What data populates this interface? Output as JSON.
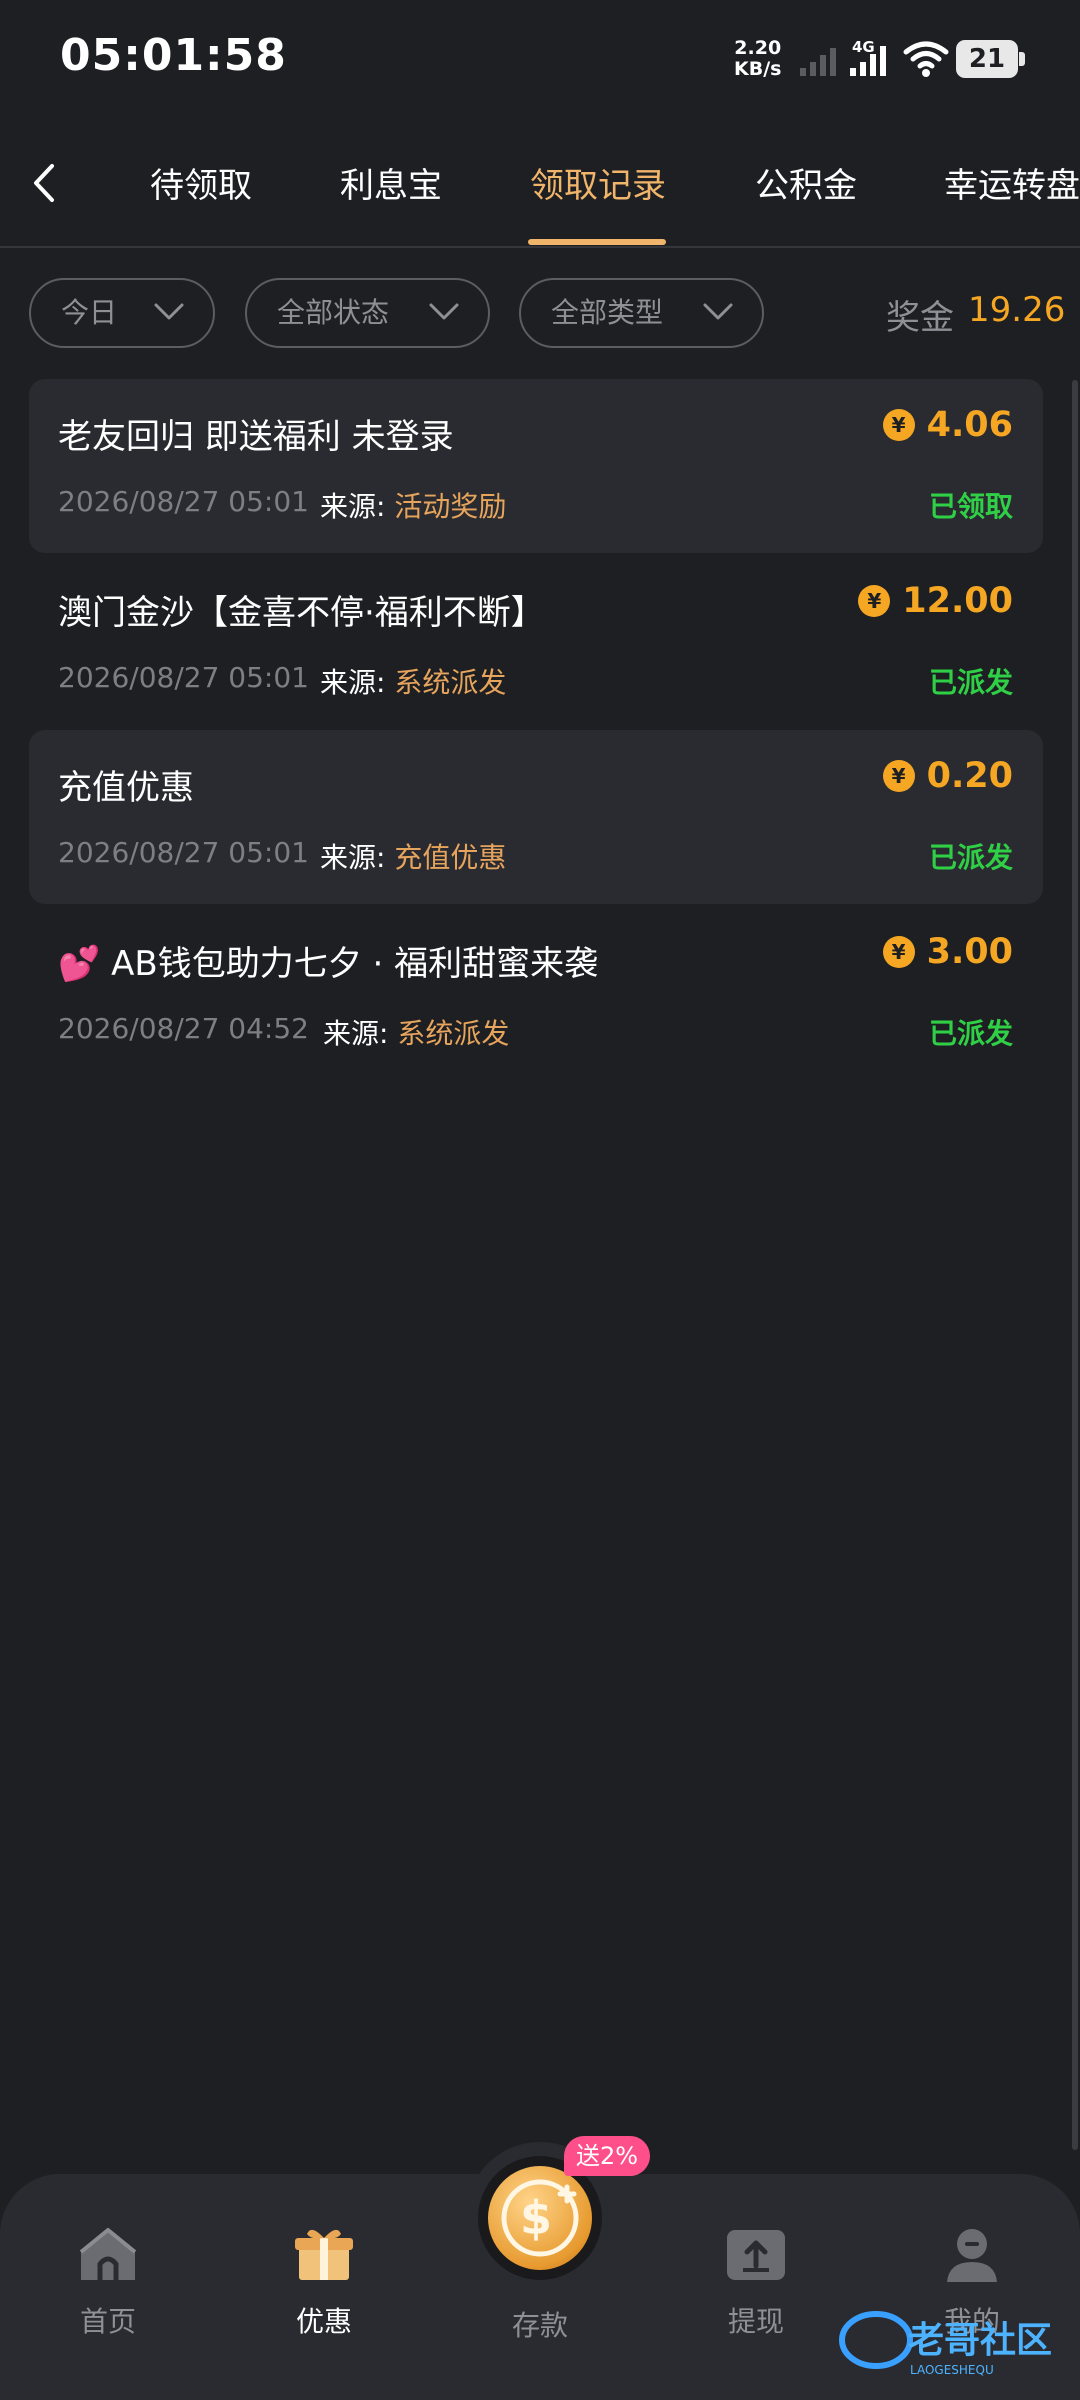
{
  "status_bar": {
    "time": "05:01:58",
    "net_speed_value": "2.20",
    "net_speed_unit": "KB/s",
    "network_type": "4G",
    "battery": "21"
  },
  "tabs": {
    "items": [
      "待领取",
      "利息宝",
      "领取记录",
      "公积金",
      "幸运转盘"
    ],
    "active": "领取记录"
  },
  "filters": {
    "date": "今日",
    "status": "全部状态",
    "type": "全部类型"
  },
  "bonus": {
    "label": "奖金",
    "value": "19.26"
  },
  "source_label": "来源:",
  "currency_symbol": "¥",
  "records": [
    {
      "title": "老友回归 即送福利 未登录",
      "date": "2026/08/27 05:01",
      "source": "活动奖励",
      "amount": "4.06",
      "status": "已领取"
    },
    {
      "title": "澳门金沙【金喜不停·福利不断】",
      "date": "2026/08/27 05:01",
      "source": "系统派发",
      "amount": "12.00",
      "status": "已派发"
    },
    {
      "title": "充值优惠",
      "date": "2026/08/27 05:01",
      "source": "充值优惠",
      "amount": "0.20",
      "status": "已派发"
    },
    {
      "title_emoji": "💕",
      "title": "AB钱包助力七夕 · 福利甜蜜来袭",
      "date": "2026/08/27 04:52",
      "source": "系统派发",
      "amount": "3.00",
      "status": "已派发"
    }
  ],
  "bottom_nav": {
    "home": "首页",
    "promo": "优惠",
    "deposit": "存款",
    "deposit_badge": "送2%",
    "withdraw": "提现",
    "mine": "我的"
  },
  "watermark": {
    "text": "老哥社区",
    "subtext": "LAOGESHEQU"
  },
  "colors": {
    "background": "#1e1f23",
    "accent": "#f0b46a",
    "amount": "#f5a623",
    "status_green": "#2fcf46",
    "badge_pink": "#ff4f8b"
  }
}
